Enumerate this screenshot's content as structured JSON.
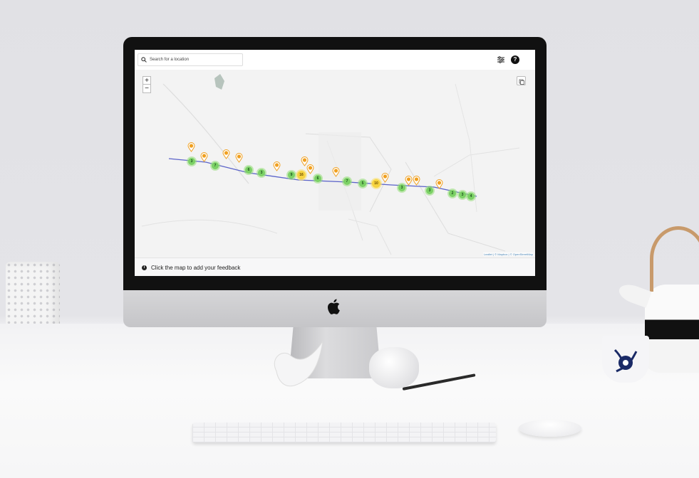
{
  "app": {
    "search": {
      "placeholder": "Search for a location"
    },
    "toolbar": {
      "filter_icon": "sliders-icon",
      "help_label": "?"
    },
    "map": {
      "zoom_in_label": "+",
      "zoom_out_label": "−",
      "attribution": "Leaflet | © Mapbox | © OpenStreetMap",
      "clusters": [
        {
          "count": "3",
          "color": "green"
        },
        {
          "count": "7",
          "color": "green"
        },
        {
          "count": "6",
          "color": "green"
        },
        {
          "count": "3",
          "color": "green"
        },
        {
          "count": "9",
          "color": "green"
        },
        {
          "count": "16",
          "color": "yellow"
        },
        {
          "count": "6",
          "color": "green"
        },
        {
          "count": "7",
          "color": "green"
        },
        {
          "count": "5",
          "color": "green"
        },
        {
          "count": "10",
          "color": "yellow"
        },
        {
          "count": "3",
          "color": "green"
        },
        {
          "count": "3",
          "color": "green"
        },
        {
          "count": "2",
          "color": "green"
        },
        {
          "count": "3",
          "color": "green"
        },
        {
          "count": "4",
          "color": "green"
        }
      ],
      "colors": {
        "route": "#5b63c9",
        "pin": "#f0a020",
        "cluster_green": "#7bd165",
        "cluster_yellow": "#f6d340"
      }
    },
    "status": {
      "info_icon": "i",
      "text": "Click the map to add your feedback"
    }
  }
}
